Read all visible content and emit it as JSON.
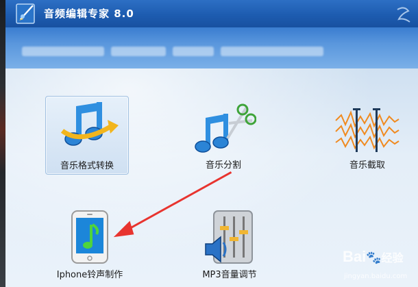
{
  "window": {
    "title": "音频编辑专家 8.0"
  },
  "banner": {
    "text_blurred": true
  },
  "tools": [
    {
      "label": "音乐格式转换",
      "icon": "music-convert-icon",
      "selected": true
    },
    {
      "label": "音乐分割",
      "icon": "music-split-icon",
      "selected": false
    },
    {
      "label": "音乐截取",
      "icon": "waveform-cut-icon",
      "selected": false
    },
    {
      "label": "Iphone铃声制作",
      "icon": "iphone-ringtone-icon",
      "selected": false
    },
    {
      "label": "MP3音量调节",
      "icon": "volume-mixer-icon",
      "selected": false
    }
  ],
  "annotation": {
    "type": "arrow",
    "color": "#e8342f"
  },
  "watermark": {
    "logo": "Bai",
    "logo_cn": "经验",
    "url": "jingyan.baidu.com"
  },
  "colors": {
    "titlebar": "#1d5cb0",
    "accent_blue": "#2b8ad8",
    "arrow_red": "#e8342f"
  }
}
